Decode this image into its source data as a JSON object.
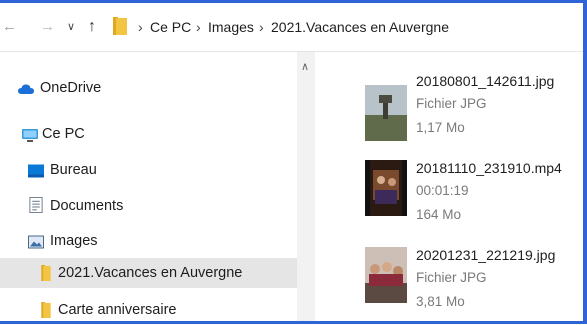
{
  "addressbar": {
    "back_icon": "back-arrow-icon",
    "forward_icon": "forward-arrow-icon",
    "recent_icon": "chevron-down-icon",
    "up_icon": "up-arrow-icon",
    "breadcrumbs": [
      "Ce PC",
      "Images",
      "2021.Vacances en Auvergne"
    ]
  },
  "sidebar": {
    "items": [
      {
        "label": "OneDrive",
        "icon": "cloud-icon"
      },
      {
        "label": "Ce PC",
        "icon": "computer-icon"
      },
      {
        "label": "Bureau",
        "icon": "desktop-icon"
      },
      {
        "label": "Documents",
        "icon": "document-icon"
      },
      {
        "label": "Images",
        "icon": "pictures-icon"
      },
      {
        "label": "2021.Vacances en Auvergne",
        "icon": "folder-icon",
        "selected": true
      },
      {
        "label": "Carte anniversaire",
        "icon": "folder-icon"
      }
    ]
  },
  "files": [
    {
      "name": "20180801_142611.jpg",
      "line1": "Fichier JPG",
      "line2": "1,17 Mo"
    },
    {
      "name": "20181110_231910.mp4",
      "line1": "00:01:19",
      "line2": "164 Mo"
    },
    {
      "name": "20201231_221219.jpg",
      "line1": "Fichier JPG",
      "line2": "3,81 Mo"
    }
  ],
  "colors": {
    "accent": "#2f64d6",
    "folder": "#f4c542",
    "selection": "#e5e5e5"
  }
}
